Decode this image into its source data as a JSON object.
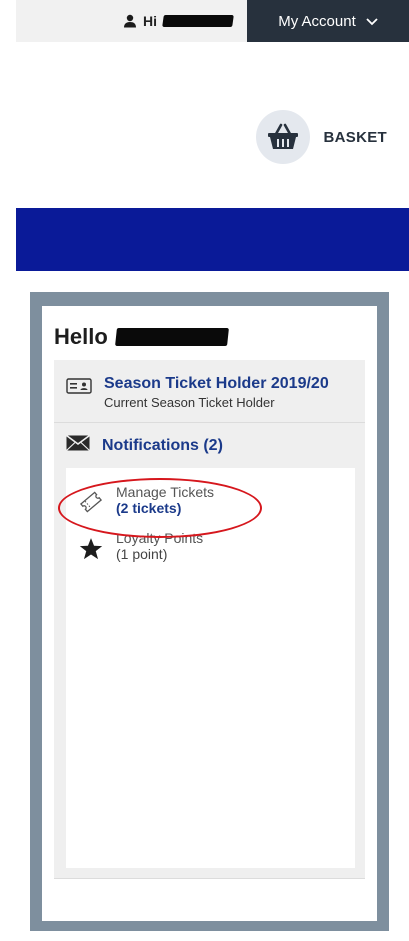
{
  "topbar": {
    "greeting": "Hi",
    "my_account_label": "My Account"
  },
  "basket": {
    "label": "BASKET"
  },
  "panel": {
    "hello": "Hello",
    "season_ticket": {
      "title": "Season Ticket Holder 2019/20",
      "subtitle": "Current Season Ticket Holder"
    },
    "notifications": {
      "label": "Notifications (2)",
      "items": [
        {
          "title": "Manage Tickets",
          "detail": "(2 tickets)"
        },
        {
          "title": "Loyalty Points",
          "detail": "(1 point)"
        }
      ]
    }
  },
  "colors": {
    "header_dark": "#27313d",
    "brand_blue": "#0a1a98",
    "link_blue": "#1b3a8a",
    "frame_grey": "#7e8f9e",
    "highlight_red": "#d6171d"
  },
  "icons": [
    "user-icon",
    "chevron-down-icon",
    "basket-icon",
    "id-card-icon",
    "envelope-icon",
    "ticket-icon",
    "star-icon"
  ]
}
